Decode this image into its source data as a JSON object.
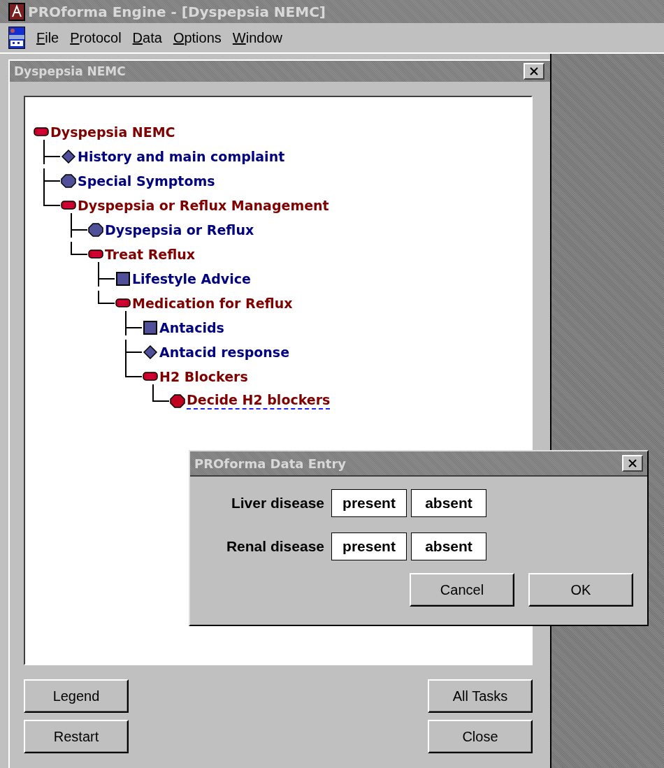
{
  "window": {
    "title": "PROforma Engine - [Dyspepsia NEMC]"
  },
  "menu": [
    {
      "label": "File"
    },
    {
      "label": "Protocol"
    },
    {
      "label": "Data"
    },
    {
      "label": "Options"
    },
    {
      "label": "Window"
    }
  ],
  "child_window": {
    "title": "Dyspepsia NEMC",
    "tree": [
      {
        "label": "Dyspepsia NEMC",
        "kind": "plan",
        "active": true,
        "current": false,
        "children": [
          {
            "label": "History and main complaint",
            "kind": "enquiry",
            "active": false,
            "current": false
          },
          {
            "label": "Special Symptoms",
            "kind": "decision",
            "active": false,
            "current": false
          },
          {
            "label": "Dyspepsia or Reflux Management",
            "kind": "plan",
            "active": true,
            "current": false,
            "children": [
              {
                "label": "Dyspepsia or Reflux",
                "kind": "decision",
                "active": false,
                "current": false
              },
              {
                "label": "Treat Reflux",
                "kind": "plan",
                "active": true,
                "current": false,
                "children": [
                  {
                    "label": "Lifestyle Advice",
                    "kind": "action",
                    "active": false,
                    "current": false
                  },
                  {
                    "label": "Medication for Reflux",
                    "kind": "plan",
                    "active": true,
                    "current": false,
                    "children": [
                      {
                        "label": "Antacids",
                        "kind": "action",
                        "active": false,
                        "current": false
                      },
                      {
                        "label": "Antacid response",
                        "kind": "enquiry",
                        "active": false,
                        "current": false
                      },
                      {
                        "label": "H2 Blockers",
                        "kind": "plan",
                        "active": true,
                        "current": false,
                        "children": [
                          {
                            "label": "Decide H2 blockers",
                            "kind": "decision",
                            "active": true,
                            "current": true
                          }
                        ]
                      }
                    ]
                  }
                ]
              }
            ]
          }
        ]
      }
    ],
    "buttons_left": [
      "Legend",
      "Restart"
    ],
    "buttons_right": [
      "All Tasks",
      "Close"
    ]
  },
  "dialog": {
    "title": "PROforma Data Entry",
    "fields": [
      {
        "label": "Liver disease",
        "options": [
          {
            "label": "present",
            "selected": false
          },
          {
            "label": "absent",
            "selected": false
          }
        ]
      },
      {
        "label": "Renal disease",
        "options": [
          {
            "label": "present",
            "selected": false
          },
          {
            "label": "absent",
            "selected": false
          }
        ]
      }
    ],
    "buttons": [
      "Cancel",
      "OK"
    ]
  }
}
